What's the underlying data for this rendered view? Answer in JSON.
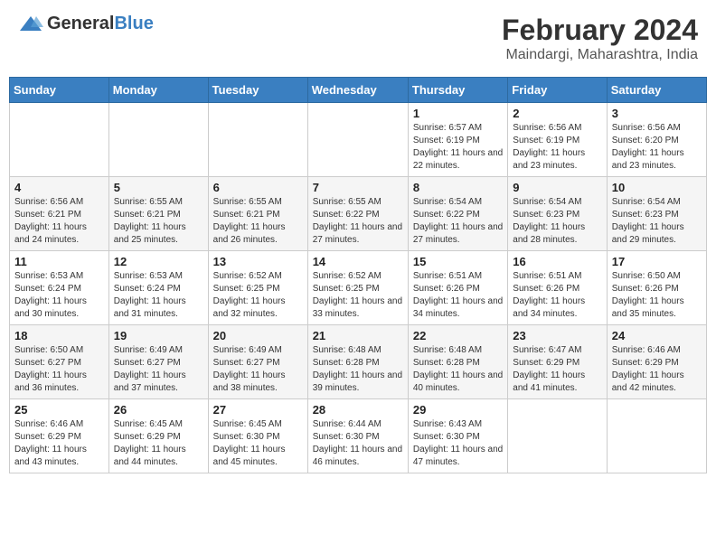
{
  "header": {
    "logo_general": "General",
    "logo_blue": "Blue",
    "title": "February 2024",
    "subtitle": "Maindargi, Maharashtra, India"
  },
  "calendar": {
    "days_of_week": [
      "Sunday",
      "Monday",
      "Tuesday",
      "Wednesday",
      "Thursday",
      "Friday",
      "Saturday"
    ],
    "weeks": [
      [
        {
          "day": "",
          "info": ""
        },
        {
          "day": "",
          "info": ""
        },
        {
          "day": "",
          "info": ""
        },
        {
          "day": "",
          "info": ""
        },
        {
          "day": "1",
          "info": "Sunrise: 6:57 AM\nSunset: 6:19 PM\nDaylight: 11 hours and 22 minutes."
        },
        {
          "day": "2",
          "info": "Sunrise: 6:56 AM\nSunset: 6:19 PM\nDaylight: 11 hours and 23 minutes."
        },
        {
          "day": "3",
          "info": "Sunrise: 6:56 AM\nSunset: 6:20 PM\nDaylight: 11 hours and 23 minutes."
        }
      ],
      [
        {
          "day": "4",
          "info": "Sunrise: 6:56 AM\nSunset: 6:21 PM\nDaylight: 11 hours and 24 minutes."
        },
        {
          "day": "5",
          "info": "Sunrise: 6:55 AM\nSunset: 6:21 PM\nDaylight: 11 hours and 25 minutes."
        },
        {
          "day": "6",
          "info": "Sunrise: 6:55 AM\nSunset: 6:21 PM\nDaylight: 11 hours and 26 minutes."
        },
        {
          "day": "7",
          "info": "Sunrise: 6:55 AM\nSunset: 6:22 PM\nDaylight: 11 hours and 27 minutes."
        },
        {
          "day": "8",
          "info": "Sunrise: 6:54 AM\nSunset: 6:22 PM\nDaylight: 11 hours and 27 minutes."
        },
        {
          "day": "9",
          "info": "Sunrise: 6:54 AM\nSunset: 6:23 PM\nDaylight: 11 hours and 28 minutes."
        },
        {
          "day": "10",
          "info": "Sunrise: 6:54 AM\nSunset: 6:23 PM\nDaylight: 11 hours and 29 minutes."
        }
      ],
      [
        {
          "day": "11",
          "info": "Sunrise: 6:53 AM\nSunset: 6:24 PM\nDaylight: 11 hours and 30 minutes."
        },
        {
          "day": "12",
          "info": "Sunrise: 6:53 AM\nSunset: 6:24 PM\nDaylight: 11 hours and 31 minutes."
        },
        {
          "day": "13",
          "info": "Sunrise: 6:52 AM\nSunset: 6:25 PM\nDaylight: 11 hours and 32 minutes."
        },
        {
          "day": "14",
          "info": "Sunrise: 6:52 AM\nSunset: 6:25 PM\nDaylight: 11 hours and 33 minutes."
        },
        {
          "day": "15",
          "info": "Sunrise: 6:51 AM\nSunset: 6:26 PM\nDaylight: 11 hours and 34 minutes."
        },
        {
          "day": "16",
          "info": "Sunrise: 6:51 AM\nSunset: 6:26 PM\nDaylight: 11 hours and 34 minutes."
        },
        {
          "day": "17",
          "info": "Sunrise: 6:50 AM\nSunset: 6:26 PM\nDaylight: 11 hours and 35 minutes."
        }
      ],
      [
        {
          "day": "18",
          "info": "Sunrise: 6:50 AM\nSunset: 6:27 PM\nDaylight: 11 hours and 36 minutes."
        },
        {
          "day": "19",
          "info": "Sunrise: 6:49 AM\nSunset: 6:27 PM\nDaylight: 11 hours and 37 minutes."
        },
        {
          "day": "20",
          "info": "Sunrise: 6:49 AM\nSunset: 6:27 PM\nDaylight: 11 hours and 38 minutes."
        },
        {
          "day": "21",
          "info": "Sunrise: 6:48 AM\nSunset: 6:28 PM\nDaylight: 11 hours and 39 minutes."
        },
        {
          "day": "22",
          "info": "Sunrise: 6:48 AM\nSunset: 6:28 PM\nDaylight: 11 hours and 40 minutes."
        },
        {
          "day": "23",
          "info": "Sunrise: 6:47 AM\nSunset: 6:29 PM\nDaylight: 11 hours and 41 minutes."
        },
        {
          "day": "24",
          "info": "Sunrise: 6:46 AM\nSunset: 6:29 PM\nDaylight: 11 hours and 42 minutes."
        }
      ],
      [
        {
          "day": "25",
          "info": "Sunrise: 6:46 AM\nSunset: 6:29 PM\nDaylight: 11 hours and 43 minutes."
        },
        {
          "day": "26",
          "info": "Sunrise: 6:45 AM\nSunset: 6:29 PM\nDaylight: 11 hours and 44 minutes."
        },
        {
          "day": "27",
          "info": "Sunrise: 6:45 AM\nSunset: 6:30 PM\nDaylight: 11 hours and 45 minutes."
        },
        {
          "day": "28",
          "info": "Sunrise: 6:44 AM\nSunset: 6:30 PM\nDaylight: 11 hours and 46 minutes."
        },
        {
          "day": "29",
          "info": "Sunrise: 6:43 AM\nSunset: 6:30 PM\nDaylight: 11 hours and 47 minutes."
        },
        {
          "day": "",
          "info": ""
        },
        {
          "day": "",
          "info": ""
        }
      ]
    ]
  }
}
